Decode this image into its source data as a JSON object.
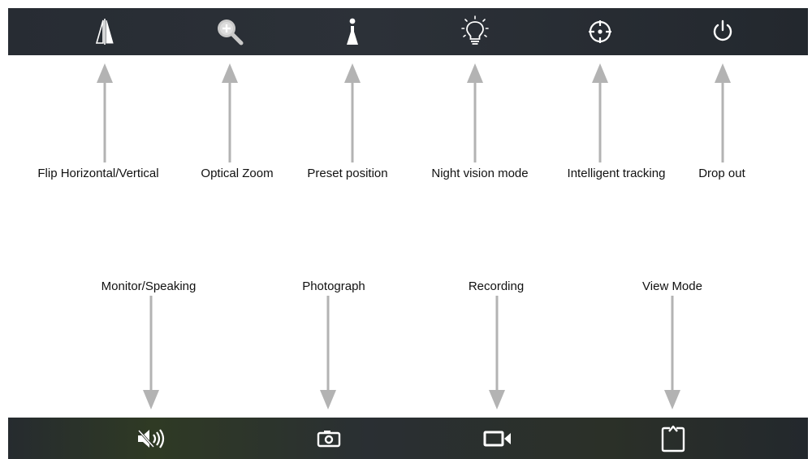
{
  "top_toolbar": {
    "buttons": [
      {
        "id": "flip",
        "icon": "flip-icon"
      },
      {
        "id": "zoom",
        "icon": "zoom-in-icon"
      },
      {
        "id": "preset",
        "icon": "preset-marker-icon"
      },
      {
        "id": "night",
        "icon": "lightbulb-icon"
      },
      {
        "id": "tracking",
        "icon": "crosshair-icon"
      },
      {
        "id": "dropout",
        "icon": "power-icon"
      }
    ]
  },
  "bottom_toolbar": {
    "buttons": [
      {
        "id": "monitor",
        "icon": "speaker-muted-icon"
      },
      {
        "id": "photo",
        "icon": "camera-icon"
      },
      {
        "id": "record",
        "icon": "video-camera-icon"
      },
      {
        "id": "view",
        "icon": "view-mode-icon"
      }
    ]
  },
  "labels": {
    "flip": "Flip Horizontal/Vertical",
    "zoom": "Optical Zoom",
    "preset": "Preset position",
    "night": "Night vision mode",
    "tracking": "Intelligent tracking",
    "dropout": "Drop out",
    "monitor": "Monitor/Speaking",
    "photo": "Photograph",
    "record": "Recording",
    "view": "View Mode"
  },
  "colors": {
    "toolbar_bg": "#2a2f35",
    "icon": "#ffffff",
    "arrow": "#b0b0b0",
    "label_text": "#111111"
  }
}
